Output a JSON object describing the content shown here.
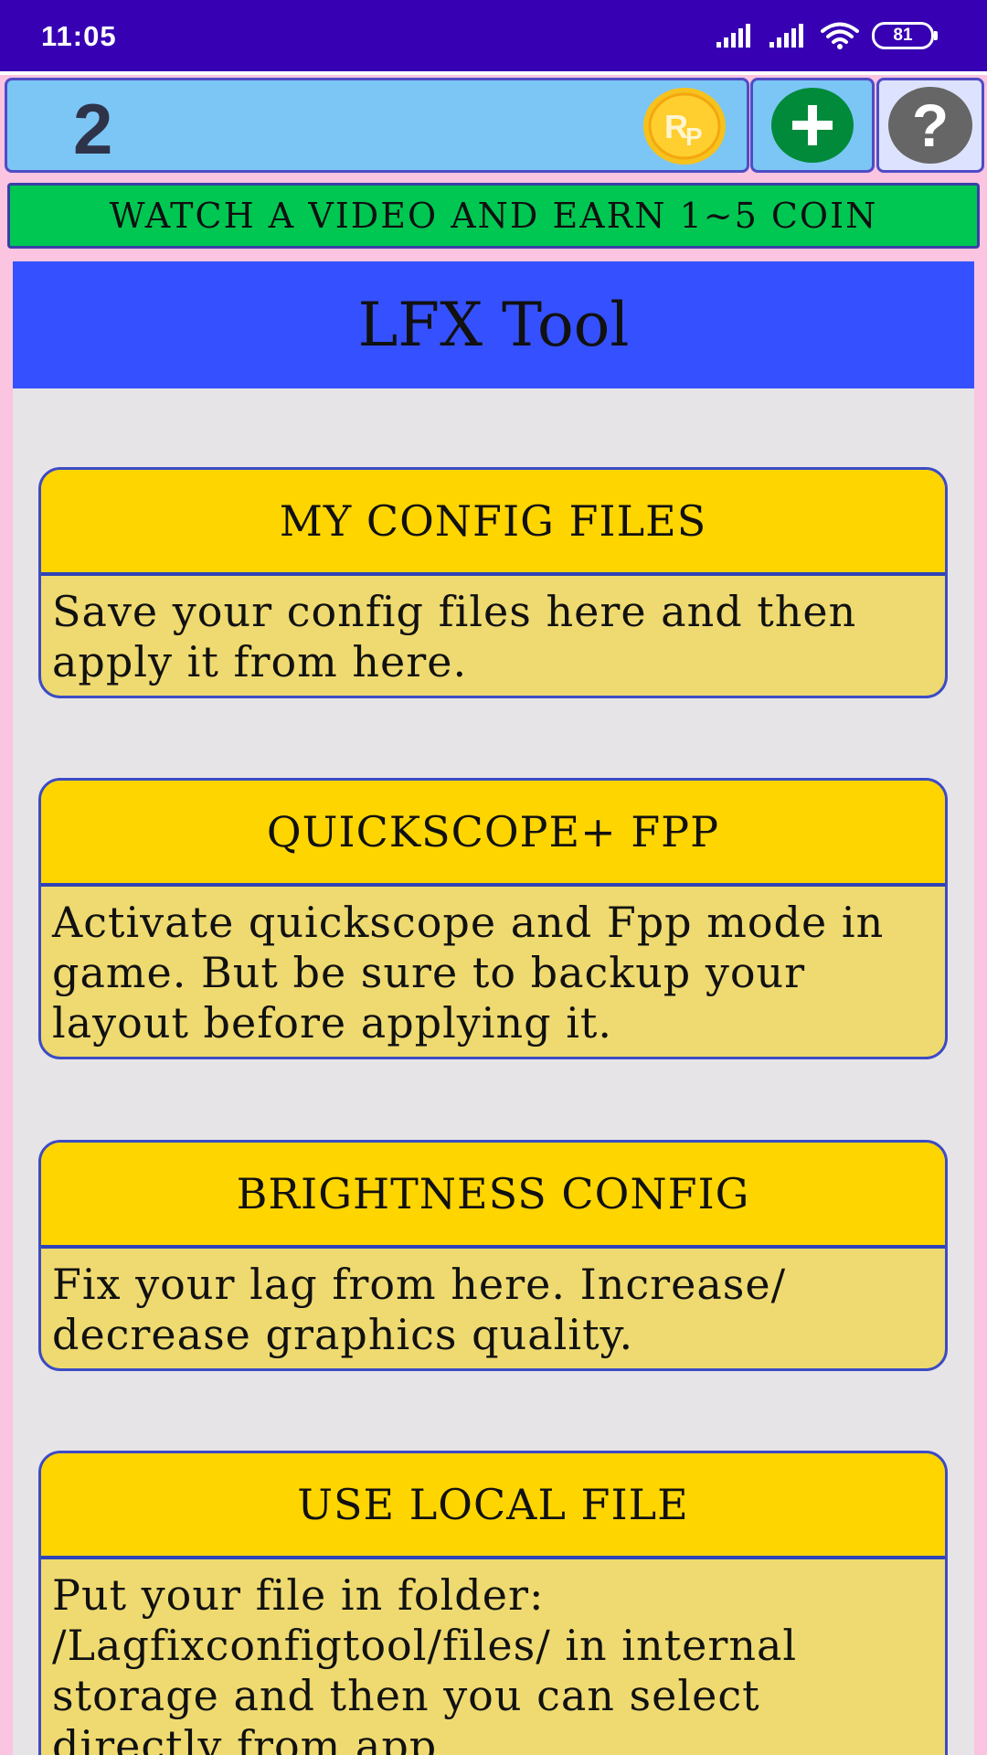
{
  "status_bar": {
    "time": "11:05",
    "battery": "81"
  },
  "header": {
    "coin_count": "2",
    "coin_badge": "Rp",
    "add_icon": "plus-icon",
    "help_icon": "question-icon"
  },
  "banner": {
    "label": "WATCH A VIDEO AND EARN 1~5 COIN"
  },
  "page": {
    "title": "LFX Tool"
  },
  "cards": [
    {
      "title": "MY CONFIG FILES",
      "description": "Save your config files here and then apply it from here."
    },
    {
      "title": "QUICKSCOPE+ FPP",
      "description": "Activate quickscope and Fpp mode in game. But be sure to backup your layout before applying it."
    },
    {
      "title": "BRIGHTNESS CONFIG",
      "description": "Fix your lag from here. Increase/ decrease graphics quality."
    },
    {
      "title": "USE LOCAL FILE",
      "description": "Put your file in folder: /Lagfixconfigtool/files/ in internal storage and then you can select directly from app."
    }
  ],
  "colors": {
    "status_bar": "#3700b3",
    "coin_bar": "#7cc6f5",
    "banner": "#00c752",
    "title_bar": "#3551ff",
    "card_head": "#ffd500",
    "card_body": "#eeda70",
    "add_button": "#008a3a",
    "help_button": "#666666"
  }
}
